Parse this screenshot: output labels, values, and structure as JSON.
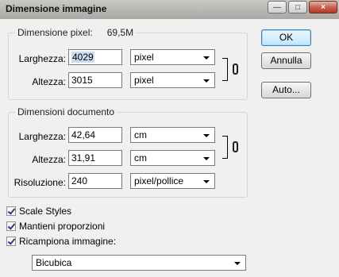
{
  "window": {
    "title": "Dimensione immagine",
    "minimize_glyph": "—",
    "maximize_glyph": "□",
    "close_glyph": "×"
  },
  "pixel_dimensions": {
    "legend": "Dimensione pixel:",
    "size": "69,5M",
    "width_label": "Larghezza:",
    "width_value": "4029",
    "width_unit": "pixel",
    "height_label": "Altezza:",
    "height_value": "3015",
    "height_unit": "pixel"
  },
  "document_size": {
    "legend": "Dimensioni documento",
    "width_label": "Larghezza:",
    "width_value": "42,64",
    "width_unit": "cm",
    "height_label": "Altezza:",
    "height_value": "31,91",
    "height_unit": "cm",
    "resolution_label": "Risoluzione:",
    "resolution_value": "240",
    "resolution_unit": "pixel/pollice"
  },
  "buttons": {
    "ok": "OK",
    "cancel": "Annulla",
    "auto": "Auto..."
  },
  "options": {
    "scale_styles": {
      "label": "Scale Styles",
      "checked": true
    },
    "constrain": {
      "label": "Mantieni proporzioni",
      "checked": true
    },
    "resample": {
      "label": "Ricampiona immagine:",
      "checked": true
    },
    "resample_method": "Bicubica"
  },
  "colors": {
    "default_button_border": "#3c7fb1",
    "selection_highlight": "#c8ddf2",
    "checkmark": "#2b3f7a"
  }
}
